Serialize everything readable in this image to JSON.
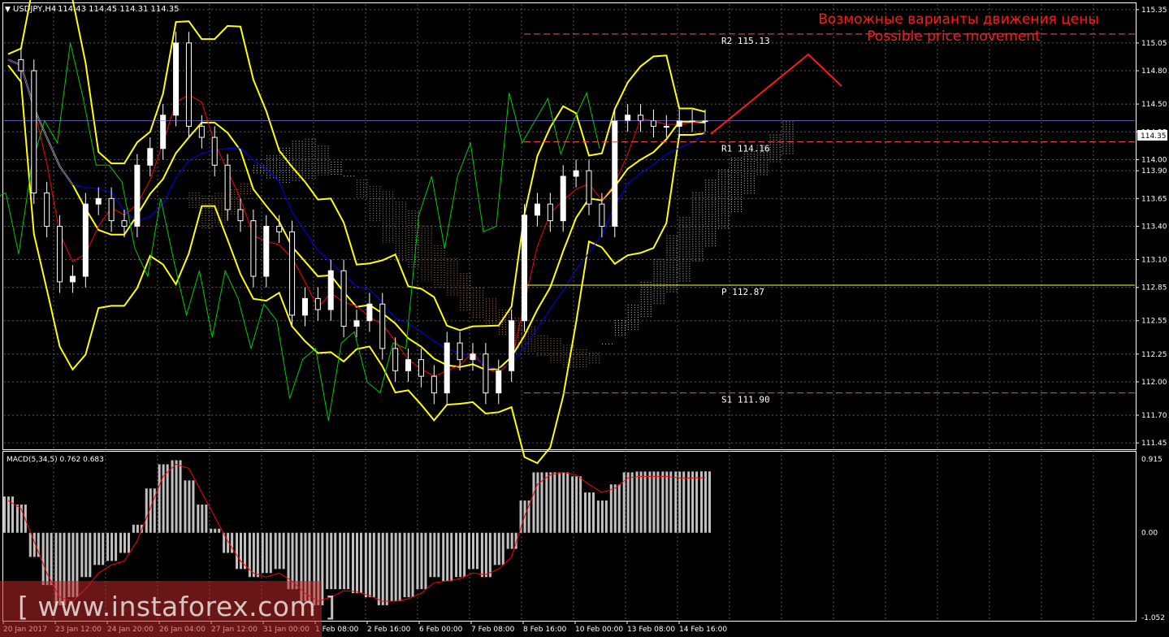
{
  "window": {
    "title": "USDJPY,H4",
    "ohlc_readout": "114.43 114.45 114.31 114.35"
  },
  "annotation": {
    "line1": "Возможные варианты движения цены",
    "line2": "Possible price movement",
    "color": "#ff1a1a"
  },
  "macd_panel": {
    "label": "MACD(5,34,5) 0.762 0.683",
    "scale_labels": [
      "0.915",
      "0.00",
      "-1.052"
    ],
    "range": [
      -1.052,
      0.915
    ],
    "histogram_color": "#c0c0c0",
    "signal_color": "#ff0000"
  },
  "price_axis": {
    "labels": [
      "115.35",
      "115.05",
      "114.80",
      "114.50",
      "114.25",
      "114.00",
      "113.90",
      "113.65",
      "113.40",
      "113.10",
      "112.85",
      "112.55",
      "112.25",
      "112.00",
      "111.70",
      "111.45"
    ],
    "current_price": "114.35",
    "range": [
      111.4,
      115.4
    ]
  },
  "time_axis": {
    "labels": [
      "20 Jan 2017",
      "23 Jan 12:00",
      "24 Jan 20:00",
      "26 Jan 04:00",
      "27 Jan 12:00",
      "31 Jan 00:00",
      "1 Feb 08:00",
      "2 Feb 16:00",
      "6 Feb 00:00",
      "7 Feb 08:00",
      "8 Feb 16:00",
      "10 Feb 00:00",
      "13 Feb 08:00",
      "14 Feb 16:00"
    ]
  },
  "levels": [
    {
      "name": "R2",
      "label": "R2 115.13",
      "value": 115.13,
      "color": "#ff4d4d"
    },
    {
      "name": "R1",
      "label": "R1 114.16",
      "value": 114.16,
      "color": "#ff4d4d"
    },
    {
      "name": "P",
      "label": "P 112.87",
      "value": 112.87,
      "color": "#ffff33"
    },
    {
      "name": "S1",
      "label": "S1 111.90",
      "value": 111.9,
      "color": "#ff4d4d"
    }
  ],
  "watermark": {
    "text": "[ www.instaforex.com ]"
  },
  "colors": {
    "background": "#000000",
    "grid": "#5a5a5a",
    "bull_candle": "#ffffff",
    "bear_candle": "#000000",
    "candle_outline": "#ffffff",
    "bollinger": "#ffff00",
    "kijun": "#ff0000",
    "tenkan": "#0000ff",
    "chikou": "#00cc00",
    "cloud_a": "#ffffff",
    "cloud_b": "#e0a070"
  },
  "chart_data": [
    {
      "type": "line",
      "title": "USDJPY,H4",
      "symbol": "USDJPY",
      "timeframe": "H4",
      "ylim": [
        111.4,
        115.4
      ],
      "x": [
        0,
        4,
        8,
        12,
        16,
        20,
        24,
        28,
        32,
        36,
        40,
        44,
        48,
        52,
        56,
        60,
        64,
        68,
        72,
        76,
        80,
        84,
        88,
        92,
        96,
        100,
        104,
        108,
        112,
        116,
        120,
        124,
        128,
        132,
        136,
        140,
        144,
        148,
        152,
        156,
        160,
        164,
        168,
        172,
        176,
        180,
        184,
        188,
        192,
        196,
        200,
        204,
        208,
        212,
        216
      ],
      "series": [
        {
          "name": "Close",
          "values": [
            114.9,
            114.8,
            113.7,
            113.4,
            112.9,
            112.95,
            113.6,
            113.65,
            113.45,
            113.4,
            113.95,
            114.1,
            114.4,
            115.05,
            114.3,
            114.2,
            113.95,
            113.55,
            113.45,
            112.95,
            113.4,
            113.35,
            112.6,
            112.75,
            112.65,
            113.0,
            112.5,
            112.55,
            112.7,
            112.3,
            112.1,
            112.2,
            112.05,
            111.9,
            112.35,
            112.2,
            112.25,
            111.9,
            112.1,
            112.55,
            113.5,
            113.6,
            113.45,
            113.85,
            113.9,
            113.6,
            113.4,
            114.35,
            114.4,
            114.35,
            114.3,
            114.3,
            114.35,
            114.35,
            114.35
          ]
        }
      ],
      "annotations": [
        "R2 115.13",
        "R1 114.16",
        "P 112.87",
        "S1 111.90"
      ]
    },
    {
      "type": "bar",
      "title": "MACD(5,34,5) 0.762 0.683",
      "ylim": [
        -1.052,
        0.915
      ],
      "x": [
        0,
        4,
        8,
        12,
        16,
        20,
        24,
        28,
        32,
        36,
        40,
        44,
        48,
        52,
        56,
        60,
        64,
        68,
        72,
        76,
        80,
        84,
        88,
        92,
        96,
        100,
        104,
        108,
        112,
        116,
        120,
        124,
        128,
        132,
        136,
        140,
        144,
        148,
        152,
        156,
        160,
        164,
        168,
        172,
        176,
        180,
        184,
        188,
        192,
        196,
        200,
        204,
        208,
        212,
        216
      ],
      "series": [
        {
          "name": "MACD",
          "values": [
            0.45,
            0.35,
            -0.3,
            -0.65,
            -0.9,
            -0.8,
            -0.55,
            -0.4,
            -0.35,
            -0.25,
            0.1,
            0.55,
            0.85,
            0.9,
            0.65,
            0.35,
            0.05,
            -0.25,
            -0.45,
            -0.55,
            -0.5,
            -0.45,
            -0.7,
            -0.85,
            -0.9,
            -0.7,
            -0.7,
            -0.75,
            -0.8,
            -0.9,
            -0.85,
            -0.8,
            -0.7,
            -0.55,
            -0.6,
            -0.55,
            -0.45,
            -0.55,
            -0.4,
            -0.2,
            0.4,
            0.75,
            0.75,
            0.75,
            0.7,
            0.5,
            0.4,
            0.6,
            0.75,
            0.76,
            0.76,
            0.76,
            0.76,
            0.76,
            0.762
          ]
        },
        {
          "name": "Signal",
          "values": [
            0.4,
            0.3,
            -0.1,
            -0.5,
            -0.8,
            -0.85,
            -0.7,
            -0.5,
            -0.4,
            -0.35,
            -0.1,
            0.3,
            0.7,
            0.85,
            0.8,
            0.5,
            0.2,
            -0.1,
            -0.35,
            -0.5,
            -0.55,
            -0.5,
            -0.6,
            -0.75,
            -0.85,
            -0.8,
            -0.72,
            -0.73,
            -0.78,
            -0.85,
            -0.85,
            -0.82,
            -0.75,
            -0.62,
            -0.6,
            -0.57,
            -0.5,
            -0.52,
            -0.45,
            -0.3,
            0.2,
            0.6,
            0.72,
            0.75,
            0.72,
            0.6,
            0.5,
            0.55,
            0.68,
            0.7,
            0.7,
            0.7,
            0.68,
            0.68,
            0.683
          ]
        }
      ]
    }
  ]
}
